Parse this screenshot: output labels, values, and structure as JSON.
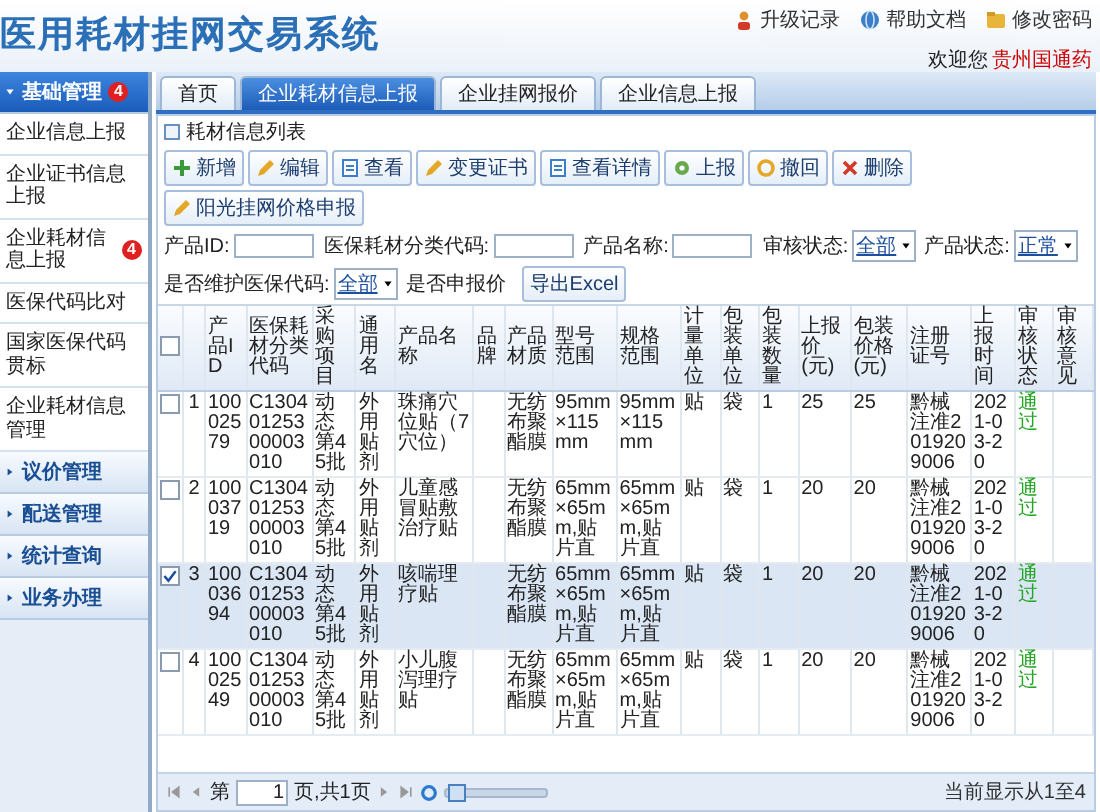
{
  "app": {
    "title": "医用耗材挂网交易系统"
  },
  "top_links": [
    {
      "label": "升级记录",
      "kind": "upgrade"
    },
    {
      "label": "帮助文档",
      "kind": "help"
    },
    {
      "label": "修改密码",
      "kind": "password"
    }
  ],
  "welcome": {
    "label": "欢迎您",
    "user": "贵州国通药"
  },
  "sidebar": {
    "groups": [
      {
        "label": "基础管理",
        "badge": "4",
        "expanded": true,
        "items": [
          {
            "label": "企业信息上报"
          },
          {
            "label": "企业证书信息上报"
          },
          {
            "label": "企业耗材信息上报",
            "badge": "4"
          },
          {
            "label": "医保代码比对"
          },
          {
            "label": "国家医保代码贯标"
          },
          {
            "label": "企业耗材信息管理"
          }
        ]
      },
      {
        "label": "议价管理",
        "expanded": false
      },
      {
        "label": "配送管理",
        "expanded": false
      },
      {
        "label": "统计查询",
        "expanded": false
      },
      {
        "label": "业务办理",
        "expanded": false
      }
    ]
  },
  "tabs": [
    {
      "label": "首页",
      "selected": false
    },
    {
      "label": "企业耗材信息上报",
      "selected": true
    },
    {
      "label": "企业挂网报价",
      "selected": false
    },
    {
      "label": "企业信息上报",
      "selected": false
    }
  ],
  "panel": {
    "title": "耗材信息列表",
    "toolbar": [
      {
        "label": "新增",
        "kind": "add"
      },
      {
        "label": "编辑",
        "kind": "edit"
      },
      {
        "label": "查看",
        "kind": "view"
      },
      {
        "label": "变更证书",
        "kind": "edit"
      },
      {
        "label": "查看详情",
        "kind": "view"
      },
      {
        "label": "上报",
        "kind": "report"
      },
      {
        "label": "撤回",
        "kind": "undo"
      },
      {
        "label": "删除",
        "kind": "delete"
      },
      {
        "label": "阳光挂网价格申报",
        "kind": "edit"
      }
    ],
    "filters": [
      {
        "label": "产品ID:",
        "kind": "text"
      },
      {
        "label": "医保耗材分类代码:",
        "kind": "text"
      },
      {
        "label": "产品名称:",
        "kind": "text"
      },
      {
        "label": "审核状态:",
        "kind": "select",
        "value": "全部"
      },
      {
        "label": "产品状态:",
        "kind": "select",
        "value": "正常"
      },
      {
        "label": "是否维护医保代码:",
        "kind": "select",
        "value": "全部"
      },
      {
        "label": "是否申报价",
        "kind": "label"
      }
    ],
    "export": "导出Excel"
  },
  "table": {
    "all_checked": false,
    "columns": [
      {
        "label": "产品ID"
      },
      {
        "label": "医保耗材分类代码"
      },
      {
        "label": "采购项目"
      },
      {
        "label": "通用名"
      },
      {
        "label": "产品名称"
      },
      {
        "label": "品牌"
      },
      {
        "label": "产品材质"
      },
      {
        "label": "型号范围"
      },
      {
        "label": "规格范围"
      },
      {
        "label": "计量单位"
      },
      {
        "label": "包装单位"
      },
      {
        "label": "包装数量"
      },
      {
        "label": "上报价(元)"
      },
      {
        "label": "包装价格(元)"
      },
      {
        "label": "注册证号"
      },
      {
        "label": "上报时间"
      },
      {
        "label": "审核状态",
        "kind": "status"
      },
      {
        "label": "审核意见"
      }
    ],
    "rows": [
      {
        "index": "1",
        "checked": false,
        "cells": [
          "10002579",
          "C13040125300003010",
          "动态第45批",
          "外用贴剂",
          "珠痛穴位贴（7穴位）",
          "",
          "无纺布聚酯膜",
          "95mm×115mm",
          "95mm×115mm",
          "贴",
          "袋",
          "1",
          "25",
          "25",
          "黔械注准2019209006",
          "2021-03-20",
          "通过",
          ""
        ]
      },
      {
        "index": "2",
        "checked": false,
        "cells": [
          "10003719",
          "C13040125300003010",
          "动态第45批",
          "外用贴剂",
          "儿童感冒贴敷治疗贴",
          "",
          "无纺布聚酯膜",
          "65mm×65mm,贴片直",
          "65mm×65mm,贴片直",
          "贴",
          "袋",
          "1",
          "20",
          "20",
          "黔械注准2019209006",
          "2021-03-20",
          "通过",
          ""
        ]
      },
      {
        "index": "3",
        "checked": true,
        "cells": [
          "10003694",
          "C13040125300003010",
          "动态第45批",
          "外用贴剂",
          "咳喘理疗贴",
          "",
          "无纺布聚酯膜",
          "65mm×65mm,贴片直",
          "65mm×65mm,贴片直",
          "贴",
          "袋",
          "1",
          "20",
          "20",
          "黔械注准2019209006",
          "2021-03-20",
          "通过",
          ""
        ]
      },
      {
        "index": "4",
        "checked": false,
        "cells": [
          "10002549",
          "C13040125300003010",
          "动态第45批",
          "外用贴剂",
          "小儿腹泻理疗贴",
          "",
          "无纺布聚酯膜",
          "65mm×65mm,贴片直",
          "65mm×65mm,贴片直",
          "贴",
          "袋",
          "1",
          "20",
          "20",
          "黔械注准2019209006",
          "2021-03-20",
          "通过",
          ""
        ]
      }
    ]
  },
  "pager": {
    "page_label": "第",
    "page": "1",
    "total": "页,共1页",
    "level": 0.1,
    "info": "当前显示从1至4"
  }
}
